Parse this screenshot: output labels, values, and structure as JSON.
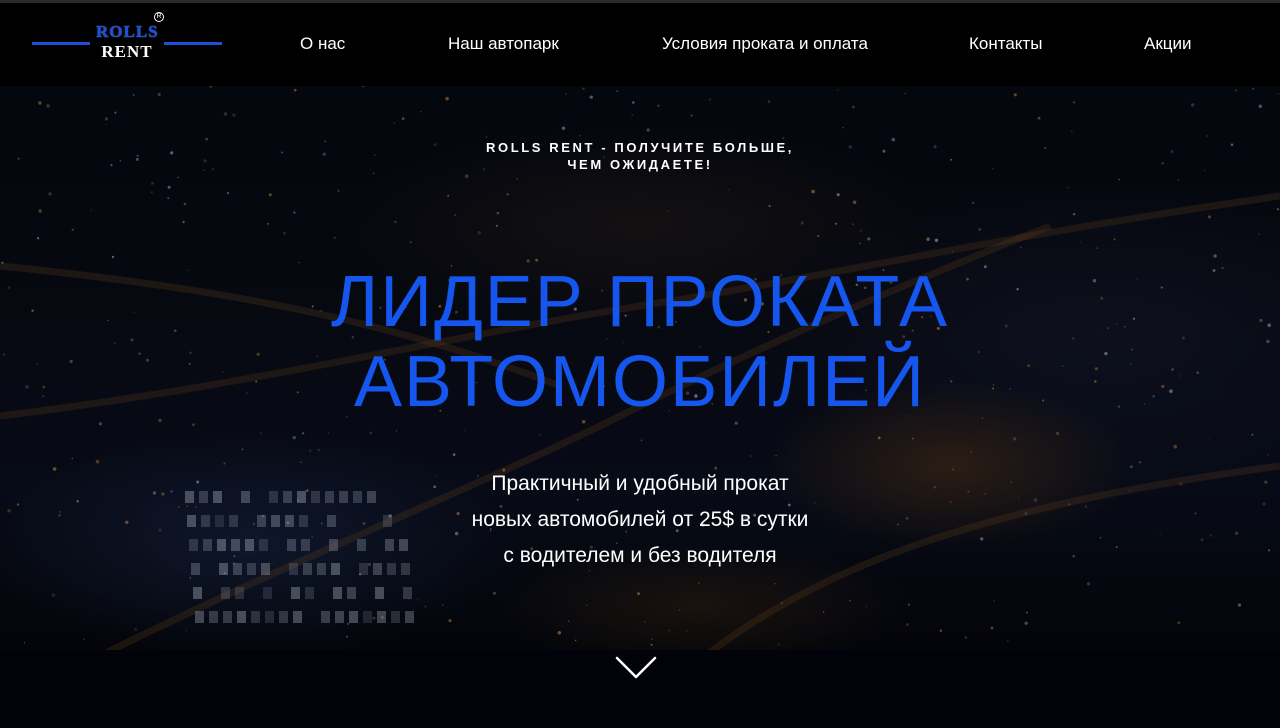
{
  "brand": {
    "logo_line1": "ROLLS",
    "logo_line2": "RENT",
    "registered_mark": "R",
    "accent_color": "#1557ee"
  },
  "nav": {
    "items": [
      {
        "label": "О нас"
      },
      {
        "label": "Наш автопарк"
      },
      {
        "label": "Условия проката и оплата"
      },
      {
        "label": "Контакты"
      },
      {
        "label": "Акции"
      }
    ]
  },
  "hero": {
    "tagline_line1": "ROLLS RENT - ПОЛУЧИТЕ БОЛЬШЕ,",
    "tagline_line2": "ЧЕМ ОЖИДАЕТЕ!",
    "headline_line1": "ЛИДЕР ПРОКАТА",
    "headline_line2": "АВТОМОБИЛЕЙ",
    "sub_line1": "Практичный и удобный прокат",
    "sub_line2": "новых автомобилей от 25$ в сутки",
    "sub_line3": "с водителем и без водителя",
    "scroll_icon": "chevron-down-icon"
  }
}
